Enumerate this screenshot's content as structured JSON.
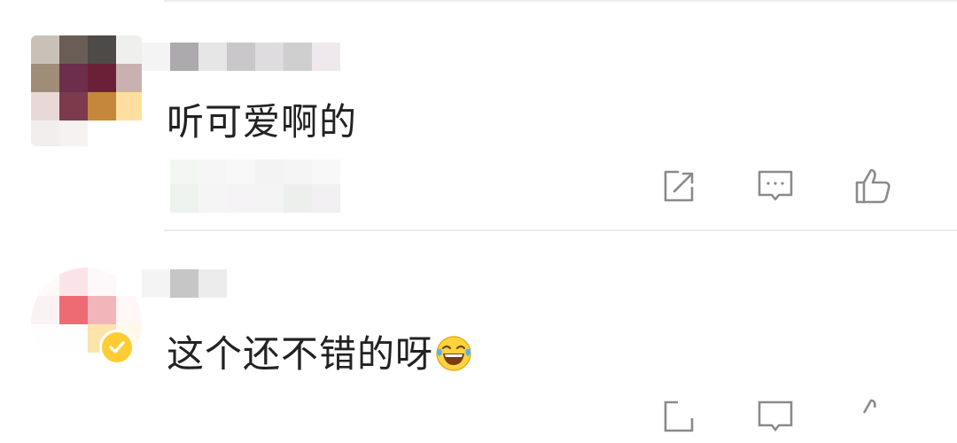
{
  "comments": [
    {
      "text": "听可爱啊的",
      "actions": {
        "share_icon": "share-icon",
        "reply_icon": "comment-icon",
        "like_icon": "like-icon"
      }
    },
    {
      "text": "这个还不错的呀",
      "emoji": "laughing-crying-emoji",
      "verified": true,
      "actions": {
        "share_icon": "share-icon",
        "reply_icon": "comment-icon",
        "like_icon": "like-icon"
      }
    }
  ],
  "colors": {
    "icon_gray": "#8a8a8a",
    "text": "#222222",
    "divider": "#ececec",
    "verified": "#ffcc33"
  }
}
